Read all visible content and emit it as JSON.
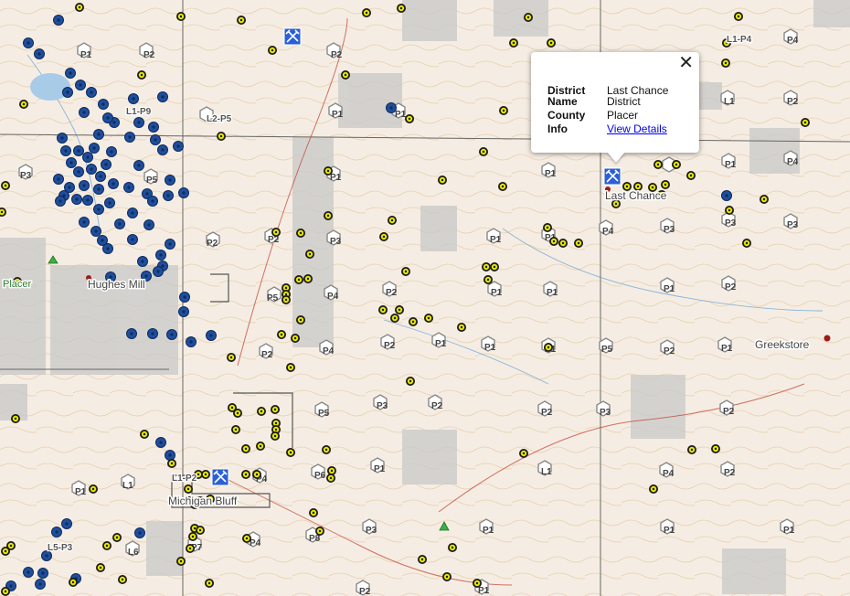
{
  "places": [
    {
      "name": "Hughes Mill"
    },
    {
      "name": "Last Chance"
    },
    {
      "name": "Greekstore"
    },
    {
      "name": "Michigan Bluff"
    },
    {
      "name": "Placer"
    }
  ],
  "claim_labels": [
    "L1-P9",
    "L2-P5",
    "L1-P4",
    "L1-P2",
    "L5-P3"
  ],
  "hex_labels": [
    "P1",
    "P2",
    "P3",
    "P4",
    "P5",
    "P6",
    "P7",
    "P8",
    "L1",
    "L6"
  ],
  "popup": {
    "rows": [
      {
        "key": "District Name",
        "value": "Last Chance District"
      },
      {
        "key": "County",
        "value": "Placer"
      },
      {
        "key": "Info",
        "value": "View Details"
      }
    ],
    "close_symbol": "✕"
  },
  "colors": {
    "blue_marker": "#1f4e9b",
    "yellow_marker": "#e6e600",
    "mine_icon": "#2a5fd6",
    "land_gray": "#bdbdbd",
    "topo_lines": "#d9b890"
  }
}
